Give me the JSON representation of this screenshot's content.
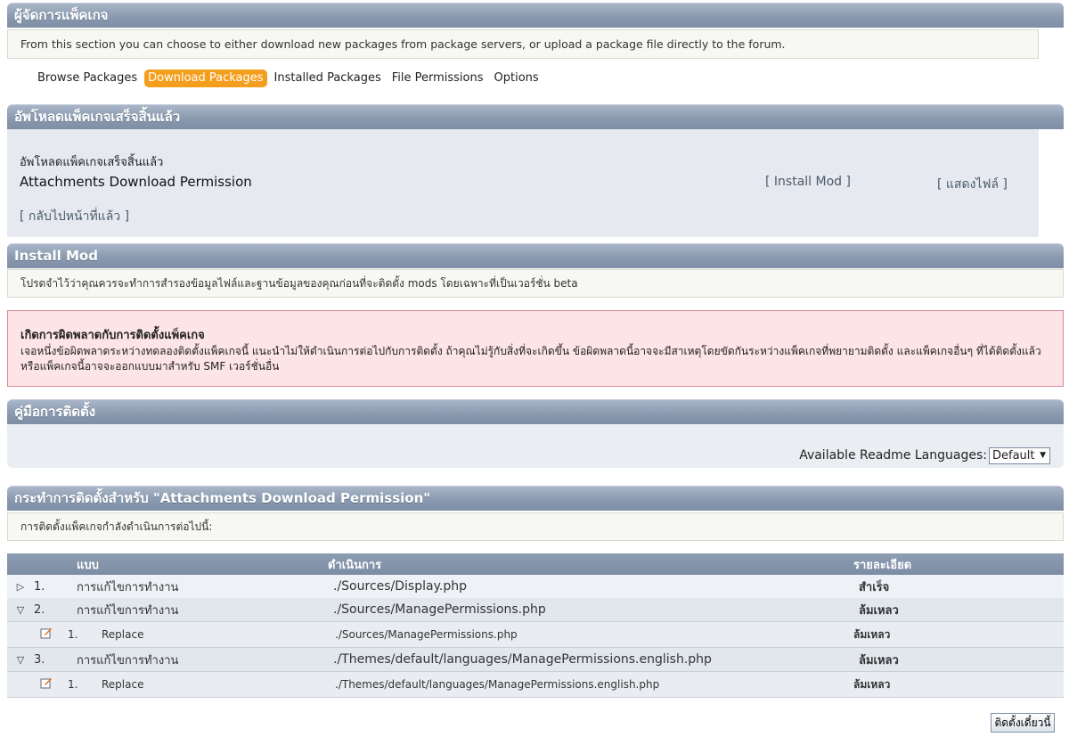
{
  "header": {
    "title": "ผู้จัดการแพ็คเกจ",
    "description": "From this section you can choose to either download new packages from package servers, or upload a package file directly to the forum."
  },
  "tabs": [
    {
      "label": "Browse Packages",
      "active": false
    },
    {
      "label": "Download Packages",
      "active": true
    },
    {
      "label": "Installed Packages",
      "active": false
    },
    {
      "label": "File Permissions",
      "active": false
    },
    {
      "label": "Options",
      "active": false
    }
  ],
  "upload": {
    "title": "อัพโหลดแพ็คเกจเสร็จสิ้นแล้ว",
    "message": "อัพโหลดแพ็คเกจเสร็จสิ้นแล้ว",
    "package_name": "Attachments Download Permission",
    "install_link": "[ Install Mod ]",
    "show_files_link": "[ แสดงไฟล์ ]",
    "back_link": "[ กลับไปหน้าที่แล้ว ]"
  },
  "install_mod": {
    "title": "Install Mod",
    "note": "โปรดจำไว้ว่าคุณควรจะทำการสำรองข้อมูลไฟล์และฐานข้อมูลของคุณก่อนที่จะติดตั้ง mods โดยเฉพาะที่เป็นเวอร์ชั่น beta"
  },
  "error": {
    "title": "เกิดการผิดพลาดกับการติดตั้งแพ็คเกจ",
    "body": "เจอหนึ่งข้อผิดพลาดระหว่างทดลองติดตั้งแพ็คเกจนี้ แนะนำไม่ให้ดำเนินการต่อไปกับการติดตั้ง ถ้าคุณไม่รู้กับสิ่งที่จะเกิดขึ้น ข้อผิดพลาดนี้อาจจะมีสาเหตุโดยขัดกันระหว่างแพ็คเกจที่พยายามติดตั้ง และแพ็คเกจอื่นๆ ที่ได้ติดตั้งแล้ว หรือแพ็คเกจนี้อาจจะออกแบบมาสำหรับ SMF เวอร์ชั่นอื่น"
  },
  "readme": {
    "title": "คู่มือการติดตั้ง",
    "languages_label": "Available Readme Languages:",
    "selected_language": "Default"
  },
  "actions": {
    "title": "กระทำการติดตั้งสำหรับ \"Attachments Download Permission\"",
    "intro": "การติดตั้งแพ็คเกจกำลังดำเนินการต่อไปนี้:",
    "headers": {
      "type": "แบบ",
      "action": "ดำเนินการ",
      "description": "รายละเอียด"
    },
    "rows": [
      {
        "num": "1.",
        "type": "การแก้ไขการทำงาน",
        "file": "./Sources/Display.php",
        "status": "สำเร็จ",
        "status_kind": "ok",
        "expanded": false
      },
      {
        "num": "2.",
        "type": "การแก้ไขการทำงาน",
        "file": "./Sources/ManagePermissions.php",
        "status": "ล้มเหลว",
        "status_kind": "fail",
        "expanded": true,
        "sub": {
          "num": "1.",
          "type": "Replace",
          "file": "./Sources/ManagePermissions.php",
          "status": "ล้มเหลว"
        }
      },
      {
        "num": "3.",
        "type": "การแก้ไขการทำงาน",
        "file": "./Themes/default/languages/ManagePermissions.english.php",
        "status": "ล้มเหลว",
        "status_kind": "fail",
        "expanded": true,
        "sub": {
          "num": "1.",
          "type": "Replace",
          "file": "./Themes/default/languages/ManagePermissions.english.php",
          "status": "ล้มเหลว"
        }
      }
    ],
    "install_button": "ติดตั้งเดี๋ยวนี้"
  },
  "icons": {
    "collapsed": "triangle-right-icon",
    "expanded": "triangle-down-icon",
    "edit": "edit-icon"
  },
  "colors": {
    "header": "#8a9aaf",
    "accent_tab": "#f49e1d",
    "error_bg": "#fde4e6",
    "fail": "#e00000"
  }
}
